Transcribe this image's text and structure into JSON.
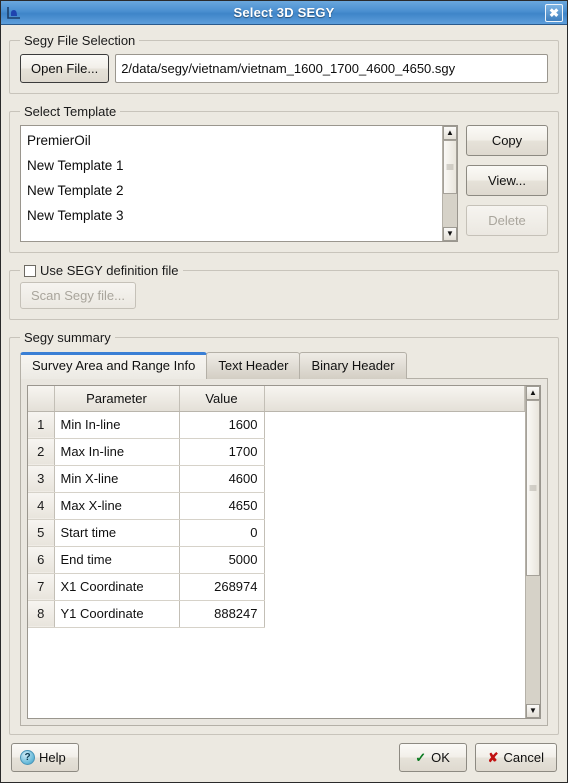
{
  "window": {
    "title": "Select 3D SEGY",
    "icon": "chart-icon",
    "close_label": "✖"
  },
  "file_selection": {
    "legend": "Segy File Selection",
    "open_button": "Open File...",
    "path_value": "2/data/segy/vietnam/vietnam_1600_1700_4600_4650.sgy"
  },
  "template": {
    "legend": "Select Template",
    "items": [
      "PremierOil",
      "New Template 1",
      "New Template 2",
      "New Template 3"
    ],
    "buttons": {
      "copy": "Copy",
      "view": "View...",
      "delete": "Delete"
    }
  },
  "definition": {
    "legend": "Use SEGY definition file",
    "checked": false,
    "scan_button": "Scan Segy file...",
    "scan_enabled": false
  },
  "summary": {
    "legend": "Segy summary",
    "tabs": [
      {
        "label": "Survey Area and Range Info",
        "active": true
      },
      {
        "label": "Text Header",
        "active": false
      },
      {
        "label": "Binary Header",
        "active": false
      }
    ],
    "table": {
      "headers": [
        "",
        "Parameter",
        "Value",
        ""
      ],
      "rows": [
        {
          "num": "1",
          "parameter": "Min In-line",
          "value": "1600"
        },
        {
          "num": "2",
          "parameter": "Max In-line",
          "value": "1700"
        },
        {
          "num": "3",
          "parameter": "Min X-line",
          "value": "4600"
        },
        {
          "num": "4",
          "parameter": "Max X-line",
          "value": "4650"
        },
        {
          "num": "5",
          "parameter": "Start time",
          "value": "0"
        },
        {
          "num": "6",
          "parameter": "End time",
          "value": "5000"
        },
        {
          "num": "7",
          "parameter": "X1 Coordinate",
          "value": "268974"
        },
        {
          "num": "8",
          "parameter": "Y1 Coordinate",
          "value": "888247"
        }
      ]
    }
  },
  "footer": {
    "help": "Help",
    "ok": "OK",
    "cancel": "Cancel",
    "ok_mark": "✓",
    "cancel_mark": "✘"
  },
  "colors": {
    "titlebar_accent": "#4a8fd0",
    "tab_accent": "#3a7fd5",
    "ok_tick": "#0a7a20",
    "cancel_cross": "#c11212",
    "background": "#ece9e1"
  }
}
